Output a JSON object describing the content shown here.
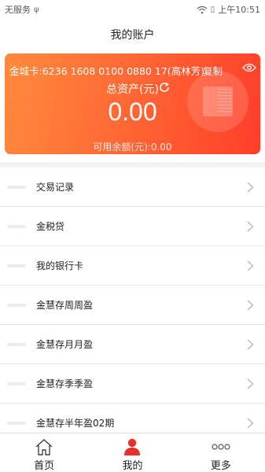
{
  "status_bar": {
    "carrier": "无服务",
    "usb_glyph": "ψ",
    "battery_glyph": "▯",
    "time": "上午10:51"
  },
  "header": {
    "title": "我的账户"
  },
  "account_card": {
    "card_number": "金城卡:6236 1608 0100 0880 17(高林芳)",
    "copy_label": "复制",
    "total_assets_label": "总资产(元)",
    "total_assets_value": "0.00",
    "available_balance": "可用余额(元):0.00",
    "gradient_colors": [
      "#ff8a3c",
      "#ff3e2a"
    ]
  },
  "menu": {
    "items": [
      {
        "label": "交易记录"
      },
      {
        "label": "金税贷"
      },
      {
        "label": "我的银行卡"
      },
      {
        "label": "金慧存周周盈"
      },
      {
        "label": "金慧存月月盈"
      },
      {
        "label": "金慧存季季盈"
      },
      {
        "label": "金慧存半年盈02期"
      }
    ]
  },
  "bottom_nav": {
    "tabs": [
      {
        "label": "首页",
        "icon": "home-icon"
      },
      {
        "label": "我的",
        "icon": "user-icon",
        "active": true,
        "active_color": "#e8302a"
      },
      {
        "label": "更多",
        "icon": "more-icon"
      }
    ]
  }
}
